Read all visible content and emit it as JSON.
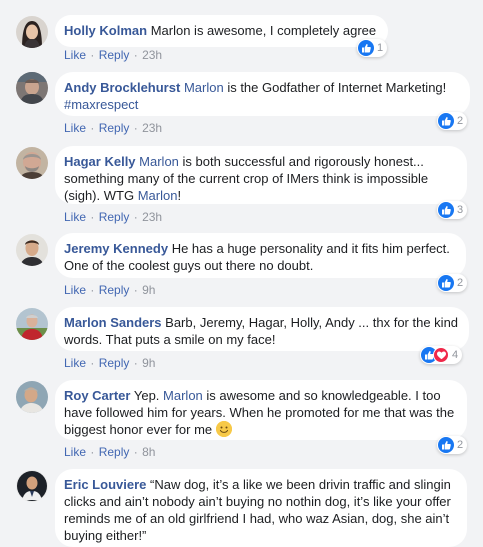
{
  "actions": {
    "like": "Like",
    "reply": "Reply",
    "separator": "·"
  },
  "comments": [
    {
      "author": "Holly Kolman",
      "text": "Marlon is awesome, I completely agree",
      "time": "23h",
      "reaction_count": "1"
    },
    {
      "author": "Andy Brocklehurst",
      "mention": "Marlon",
      "text": "is the Godfather of Internet Marketing!",
      "hashtag": "#maxrespect",
      "time": "23h",
      "reaction_count": "2"
    },
    {
      "author": "Hagar Kelly",
      "mention": "Marlon",
      "text": "is both successful and rigorously honest... something many of the current crop of IMers think is impossible (sigh). WTG",
      "mention2": "Marlon",
      "text2": "!",
      "time": "23h",
      "reaction_count": "3"
    },
    {
      "author": "Jeremy Kennedy",
      "text": "He has a huge personality and it fits him perfect. One of the coolest guys out there no doubt.",
      "time": "9h",
      "reaction_count": "2"
    },
    {
      "author": "Marlon Sanders",
      "text": "Barb, Jeremy, Hagar, Holly, Andy ... thx for the kind words. That puts a smile on my face!",
      "time": "9h",
      "reaction_count": "4"
    },
    {
      "author": "Roy Carter",
      "text": "Yep.",
      "mention": "Marlon",
      "text2": "is awesome and so knowledgeable. I too have followed him for years. When he promoted for me that was the biggest honor ever for me",
      "time": "8h",
      "reaction_count": "2"
    },
    {
      "author": "Eric Louviere",
      "text": "“Naw dog, it’s a like we been drivin traffic and slingin clicks and ain’t nobody ain’t buying no nothin dog, it’s like your offer reminds me of an old girlfriend I had, who waz Asian, dog, she ain’t buying either!”"
    }
  ],
  "colors": {
    "name": "#385898",
    "link": "#4267b2",
    "like_blue": "#1877f2",
    "love_red": "#f0284a",
    "background": "#f2f3f5"
  },
  "icons": {
    "like": "thumbs-up-icon",
    "love": "heart-icon",
    "smile": "smiley-emoji-icon"
  }
}
